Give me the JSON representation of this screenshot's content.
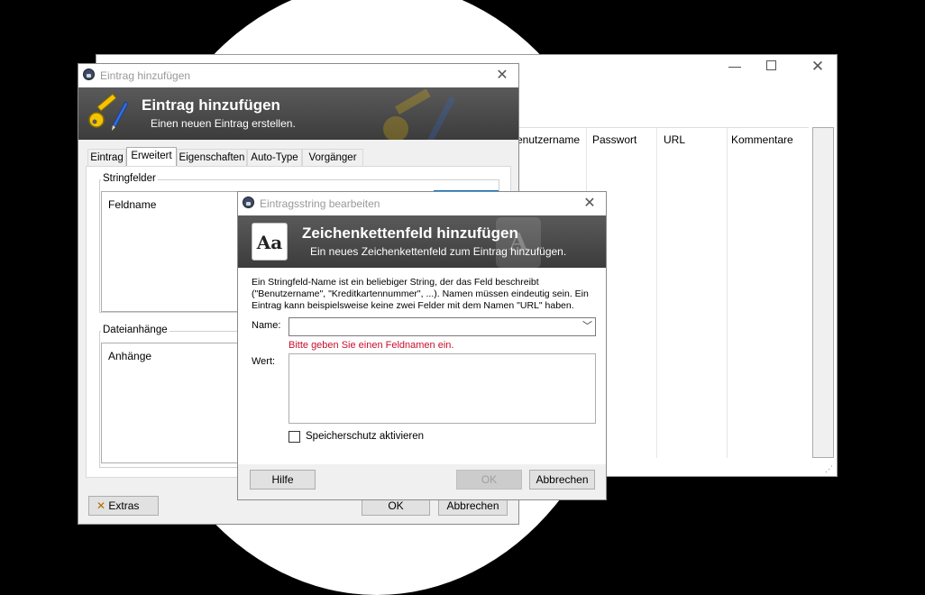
{
  "main_window": {
    "columns": [
      "enutzername",
      "Passwort",
      "URL",
      "Kommentare"
    ]
  },
  "entry_dialog": {
    "title": "Eintrag hinzufügen",
    "banner_heading": "Eintrag hinzufügen",
    "banner_subtitle": "Einen neuen Eintrag erstellen.",
    "tabs": [
      "Eintrag",
      "Erweitert",
      "Eigenschaften",
      "Auto-Type",
      "Vorgänger"
    ],
    "active_tab": "Erweitert",
    "string_fields_group": "Stringfelder",
    "string_fields_column": "Feldname",
    "attachments_group": "Dateianhänge",
    "attachments_column": "Anhänge",
    "extras_button": "Extras",
    "ok_button": "OK",
    "cancel_button": "Abbrechen"
  },
  "string_dialog": {
    "title": "Eintragsstring bearbeiten",
    "banner_heading": "Zeichenkettenfeld hinzufügen",
    "banner_subtitle": "Ein neues Zeichenkettenfeld zum Eintrag hinzufügen.",
    "icon_text": "Aa",
    "description": "Ein Stringfeld-Name ist ein beliebiger String, der das Feld beschreibt (\"Benutzername\", \"Kreditkartennummer\", ...). Namen müssen eindeutig sein. Ein Eintrag kann beispielsweise keine zwei Felder mit dem Namen \"URL\" haben.",
    "name_label": "Name:",
    "name_value": "",
    "name_error": "Bitte geben Sie einen Feldnamen ein.",
    "value_label": "Wert:",
    "value_value": "",
    "protect_label": "Speicherschutz aktivieren",
    "protect_checked": false,
    "help_button": "Hilfe",
    "ok_button": "OK",
    "cancel_button": "Abbrechen"
  },
  "colors": {
    "error_text": "#c8102e",
    "accent_border": "#0078d7"
  }
}
